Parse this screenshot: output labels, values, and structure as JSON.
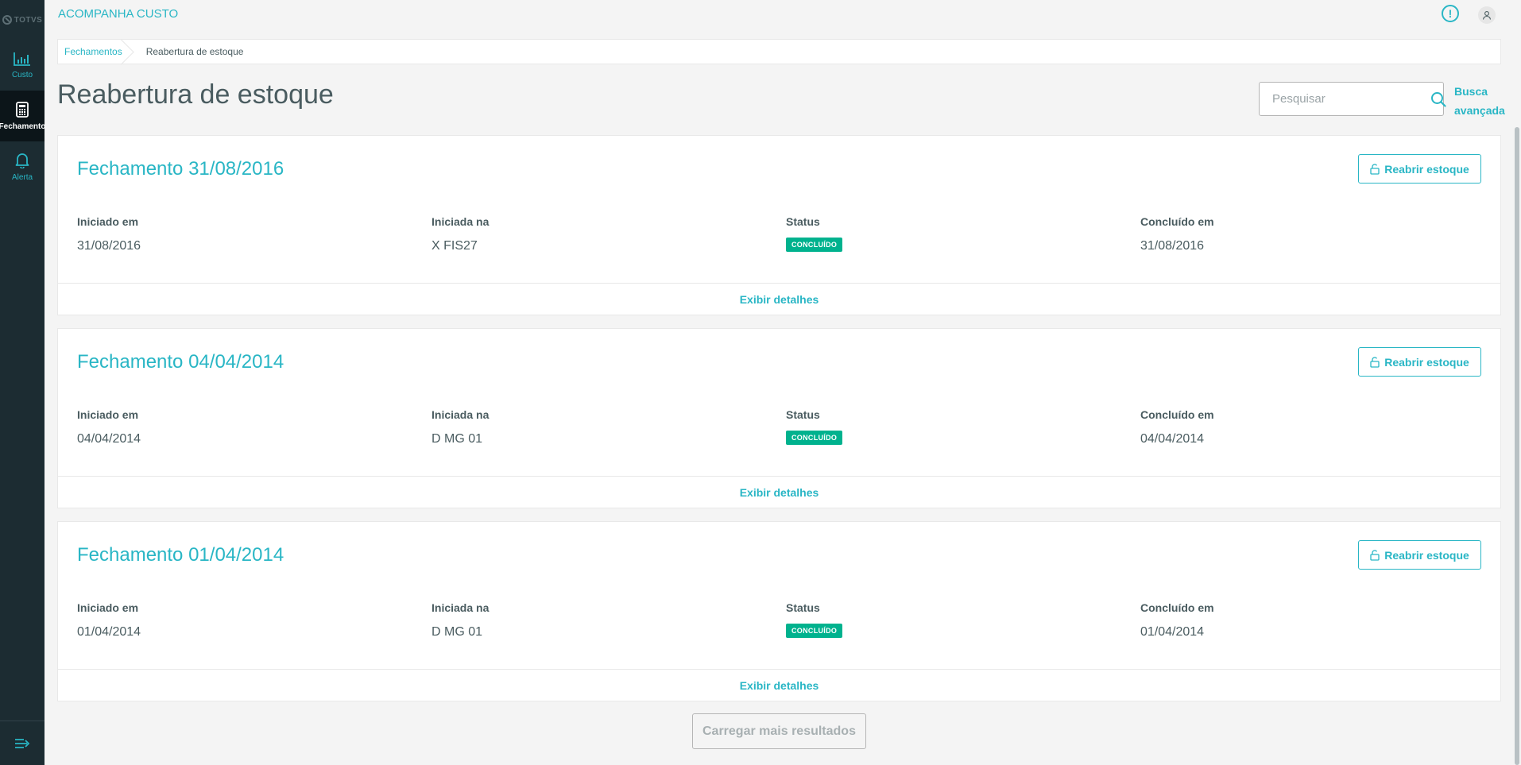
{
  "brand": {
    "logo_text": "TOTVS"
  },
  "sidebar": {
    "items": [
      {
        "label": "Custo",
        "icon": "bar-chart-icon",
        "active": false
      },
      {
        "label": "Fechamento",
        "icon": "calculator-icon",
        "active": true
      },
      {
        "label": "Alerta",
        "icon": "bell-icon",
        "active": false
      }
    ],
    "toggle_icon": "menu-collapse-icon"
  },
  "header": {
    "title": "ACOMPANHA CUSTO",
    "info_icon": "!"
  },
  "breadcrumb": {
    "parent": "Fechamentos",
    "current": "Reabertura de estoque"
  },
  "page": {
    "title": "Reabertura de estoque",
    "search_placeholder": "Pesquisar",
    "advanced_search": "Busca avançada"
  },
  "labels": {
    "started_on": "Iniciado em",
    "started_at": "Iniciada na",
    "status": "Status",
    "completed_on": "Concluído em",
    "reopen_button": "Reabrir estoque",
    "details_link": "Exibir detalhes"
  },
  "closings": [
    {
      "title": "Fechamento 31/08/2016",
      "started_on": "31/08/2016",
      "started_at": "X FIS27",
      "status": "CONCLUÍDO",
      "completed_on": "31/08/2016"
    },
    {
      "title": "Fechamento 04/04/2014",
      "started_on": "04/04/2014",
      "started_at": "D MG 01",
      "status": "CONCLUÍDO",
      "completed_on": "04/04/2014"
    },
    {
      "title": "Fechamento 01/04/2014",
      "started_on": "01/04/2014",
      "started_at": "D MG 01",
      "status": "CONCLUÍDO",
      "completed_on": "01/04/2014"
    }
  ],
  "load_more": "Carregar mais resultados",
  "colors": {
    "accent": "#29b6c5",
    "success": "#00b28e",
    "sidebar": "#1c2c32"
  }
}
